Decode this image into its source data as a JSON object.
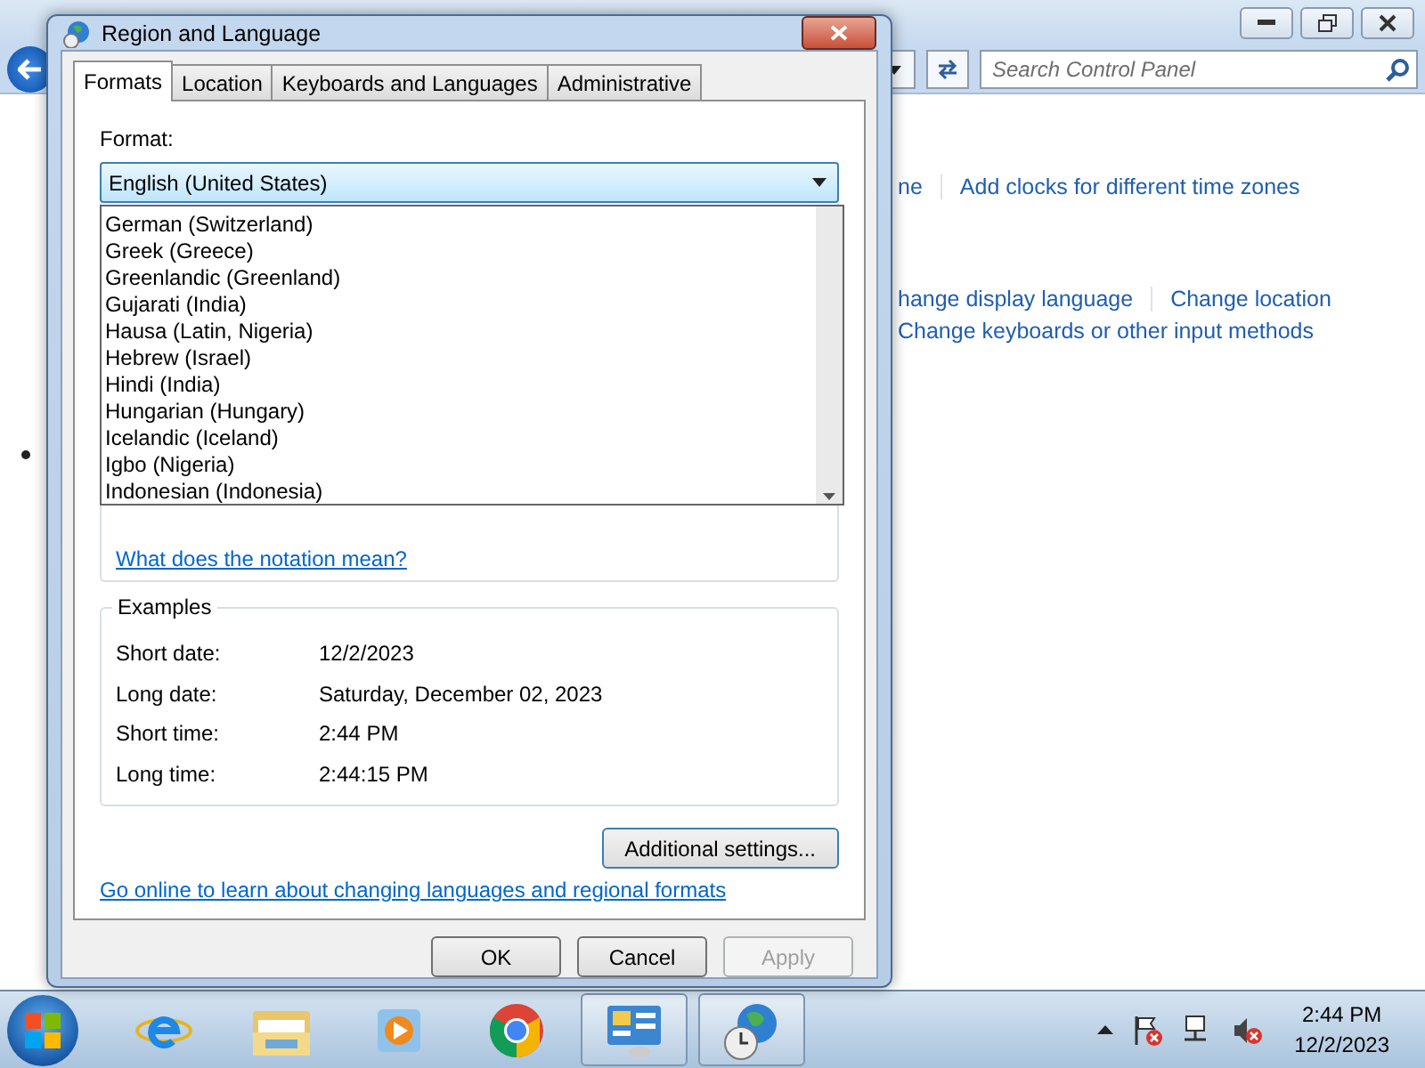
{
  "background_window": {
    "search": {
      "placeholder": "Search Control Panel"
    },
    "link_rows": [
      {
        "links": [
          "ne",
          "Add clocks for different time zones"
        ]
      },
      {
        "links": [
          "hange display language",
          "Change location"
        ]
      },
      {
        "links": [
          "Change keyboards or other input methods"
        ]
      }
    ]
  },
  "dialog": {
    "title": "Region and Language",
    "tabs": [
      {
        "label": "Formats",
        "selected": true
      },
      {
        "label": "Location",
        "selected": false
      },
      {
        "label": "Keyboards and Languages",
        "selected": false
      },
      {
        "label": "Administrative",
        "selected": false
      }
    ],
    "format_label": "Format:",
    "format_value": "English (United States)",
    "dropdown_items": [
      "German (Switzerland)",
      "Greek (Greece)",
      "Greenlandic (Greenland)",
      "Gujarati (India)",
      "Hausa (Latin, Nigeria)",
      "Hebrew (Israel)",
      "Hindi (India)",
      "Hungarian (Hungary)",
      "Icelandic (Iceland)",
      "Igbo (Nigeria)",
      "Indonesian (Indonesia)"
    ],
    "notation_link": "What does the notation mean?",
    "examples": {
      "title": "Examples",
      "rows": [
        {
          "label": "Short date:",
          "value": "12/2/2023"
        },
        {
          "label": "Long date:",
          "value": "Saturday, December 02, 2023"
        },
        {
          "label": "Short time:",
          "value": "2:44 PM"
        },
        {
          "label": "Long time:",
          "value": "2:44:15 PM"
        }
      ]
    },
    "additional_button": "Additional settings...",
    "online_link": "Go online to learn about changing languages and regional formats",
    "buttons": [
      {
        "label": "OK",
        "disabled": false
      },
      {
        "label": "Cancel",
        "disabled": false
      },
      {
        "label": "Apply",
        "disabled": true
      }
    ]
  },
  "taskbar": {
    "items": [
      {
        "kind": "browser",
        "running": false
      },
      {
        "kind": "folder",
        "running": false
      },
      {
        "kind": "media",
        "running": false
      },
      {
        "kind": "chrome",
        "running": false
      },
      {
        "kind": "panel",
        "running": true
      },
      {
        "kind": "globe",
        "running": true
      }
    ],
    "clock": {
      "time": "2:44 PM",
      "date": "12/2/2023"
    }
  }
}
